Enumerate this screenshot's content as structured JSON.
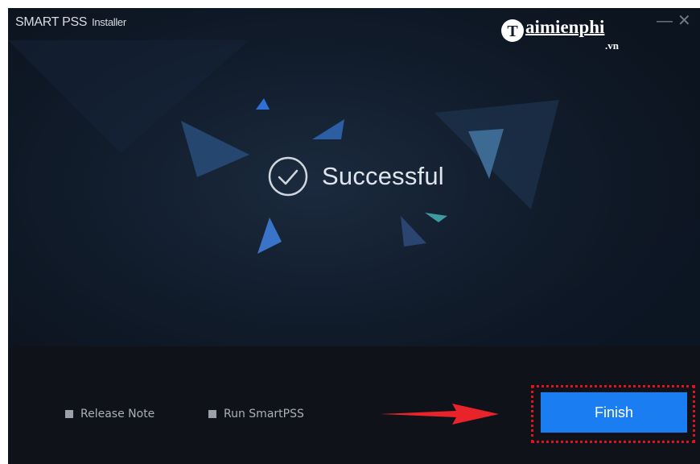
{
  "window": {
    "title_main": "SMART PSS",
    "title_suffix": "Installer",
    "minimize_glyph": "—",
    "close_glyph": "✕"
  },
  "watermark": {
    "brand": "aimienphi",
    "brand_initial": "T",
    "suffix": ".vn"
  },
  "status": {
    "icon": "check-circle-icon",
    "text": "Successful"
  },
  "options": {
    "release_note": "Release Note",
    "run_smartpss": "Run SmartPSS"
  },
  "actions": {
    "finish_label": "Finish"
  },
  "colors": {
    "accent": "#1a7ef2",
    "highlight": "#e0121e",
    "window_bg": "#111c2b"
  }
}
